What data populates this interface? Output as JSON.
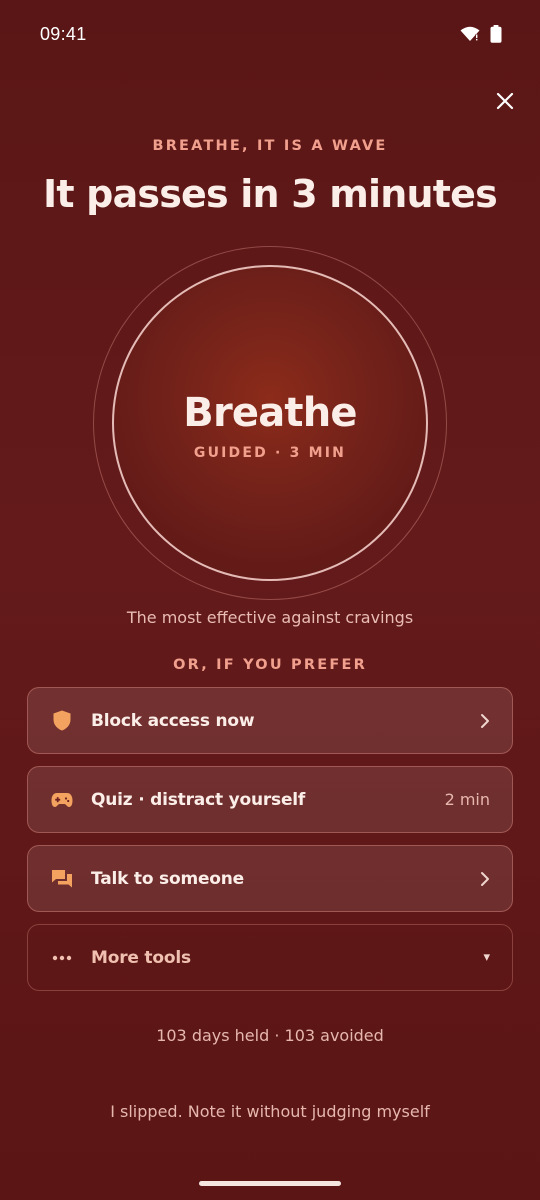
{
  "status_bar": {
    "time": "09:41",
    "icons": [
      "wifi-icon",
      "battery-icon"
    ]
  },
  "close_icon": "close-icon",
  "header": {
    "eyebrow": "BREATHE, IT IS A WAVE",
    "title": "It passes in 3 minutes"
  },
  "breathe": {
    "title": "Breathe",
    "subtitle": "GUIDED · 3 MIN",
    "caption": "The most effective against cravings"
  },
  "alternatives": {
    "heading": "OR, IF YOU PREFER",
    "items": [
      {
        "label": "Block access now",
        "icon": "shield-icon",
        "right": "chevron-right-icon"
      },
      {
        "label": "Quiz · distract yourself",
        "icon": "gamepad-icon",
        "right_text": "2 min"
      },
      {
        "label": "Talk to someone",
        "icon": "chat-icon",
        "right": "chevron-right-icon"
      },
      {
        "label": "More tools",
        "icon": "more-dots-icon",
        "right": "dropdown-caret-icon",
        "right_glyph": "▾"
      }
    ]
  },
  "stats": "103 days held · 103 avoided",
  "slip_link": "I slipped. Note it without judging myself",
  "colors": {
    "background": "#5f1818",
    "accent": "#f2a08e",
    "icon_orange": "#f3a25f",
    "text": "#fbeee8"
  }
}
